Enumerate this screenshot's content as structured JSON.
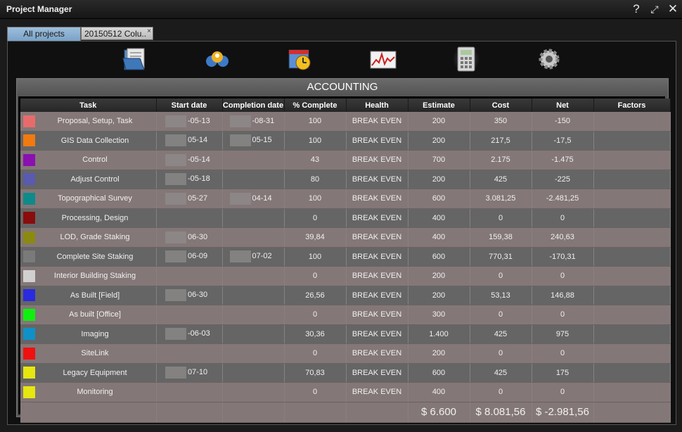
{
  "app": {
    "title": "Project Manager"
  },
  "window_controls": {
    "help": "?",
    "restore": "⤢",
    "close": "✕"
  },
  "tabs": [
    {
      "label": "All projects",
      "active": true
    },
    {
      "label": "20150512 Colu..",
      "close": "×"
    }
  ],
  "toolbar": [
    {
      "name": "documents-icon"
    },
    {
      "name": "people-icon"
    },
    {
      "name": "calendar-clock-icon"
    },
    {
      "name": "chart-icon"
    },
    {
      "name": "calculator-icon",
      "active": true
    },
    {
      "name": "gear-icon"
    }
  ],
  "section": {
    "title": "ACCOUNTING"
  },
  "columns": [
    "Task",
    "Start date",
    "Completion date",
    "% Complete",
    "Health",
    "Estimate",
    "Cost",
    "Net",
    "Factors"
  ],
  "rows": [
    {
      "color": "#e86b6b",
      "task": "Proposal, Setup, Task",
      "start": "-05-13",
      "complete": "-08-31",
      "pct": "100",
      "health": "BREAK EVEN",
      "estimate": "200",
      "cost": "350",
      "net": "-150"
    },
    {
      "color": "#f07a10",
      "task": "GIS Data Collection",
      "start": "05-14",
      "complete": "05-15",
      "pct": "100",
      "health": "BREAK EVEN",
      "estimate": "200",
      "cost": "217,5",
      "net": "-17,5"
    },
    {
      "color": "#8a10b0",
      "task": "Control",
      "start": "-05-14",
      "complete": "",
      "pct": "43",
      "health": "BREAK EVEN",
      "estimate": "700",
      "cost": "2.175",
      "net": "-1.475"
    },
    {
      "color": "#5a5ab0",
      "task": "Adjust Control",
      "start": "-05-18",
      "complete": "",
      "pct": "80",
      "health": "BREAK EVEN",
      "estimate": "200",
      "cost": "425",
      "net": "-225"
    },
    {
      "color": "#0f8a8a",
      "task": "Topographical Survey",
      "start": "05-27",
      "complete": "04-14",
      "pct": "100",
      "health": "BREAK EVEN",
      "estimate": "600",
      "cost": "3.081,25",
      "net": "-2.481,25"
    },
    {
      "color": "#8a0c0c",
      "task": "Processing, Design",
      "start": "",
      "complete": "",
      "pct": "0",
      "health": "BREAK EVEN",
      "estimate": "400",
      "cost": "0",
      "net": "0"
    },
    {
      "color": "#8a8a10",
      "task": "LOD, Grade Staking",
      "start": "06-30",
      "complete": "",
      "pct": "39,84",
      "health": "BREAK EVEN",
      "estimate": "400",
      "cost": "159,38",
      "net": "240,63"
    },
    {
      "color": "#7a7a7a",
      "task": "Complete Site Staking",
      "start": "06-09",
      "complete": "07-02",
      "pct": "100",
      "health": "BREAK EVEN",
      "estimate": "600",
      "cost": "770,31",
      "net": "-170,31"
    },
    {
      "color": "#d0d0d0",
      "task": "Interior Building Staking",
      "start": "",
      "complete": "",
      "pct": "0",
      "health": "BREAK EVEN",
      "estimate": "200",
      "cost": "0",
      "net": "0"
    },
    {
      "color": "#2a2ae0",
      "task": "As Built [Field]",
      "start": "06-30",
      "complete": "",
      "pct": "26,56",
      "health": "BREAK EVEN",
      "estimate": "200",
      "cost": "53,13",
      "net": "146,88"
    },
    {
      "color": "#10f010",
      "task": "As built [Office]",
      "start": "",
      "complete": "",
      "pct": "0",
      "health": "BREAK EVEN",
      "estimate": "300",
      "cost": "0",
      "net": "0"
    },
    {
      "color": "#1090c8",
      "task": "Imaging",
      "start": "-06-03",
      "complete": "",
      "pct": "30,36",
      "health": "BREAK EVEN",
      "estimate": "1.400",
      "cost": "425",
      "net": "975"
    },
    {
      "color": "#f01010",
      "task": "SiteLink",
      "start": "",
      "complete": "",
      "pct": "0",
      "health": "BREAK EVEN",
      "estimate": "200",
      "cost": "0",
      "net": "0"
    },
    {
      "color": "#e6e610",
      "task": "Legacy Equipment",
      "start": "07-10",
      "complete": "",
      "pct": "70,83",
      "health": "BREAK EVEN",
      "estimate": "600",
      "cost": "425",
      "net": "175"
    },
    {
      "color": "#e6e610",
      "task": "Monitoring",
      "start": "",
      "complete": "",
      "pct": "0",
      "health": "BREAK EVEN",
      "estimate": "400",
      "cost": "0",
      "net": "0"
    }
  ],
  "totals": {
    "estimate": "$ 6.600",
    "cost": "$ 8.081,56",
    "net": "$ -2.981,56"
  }
}
